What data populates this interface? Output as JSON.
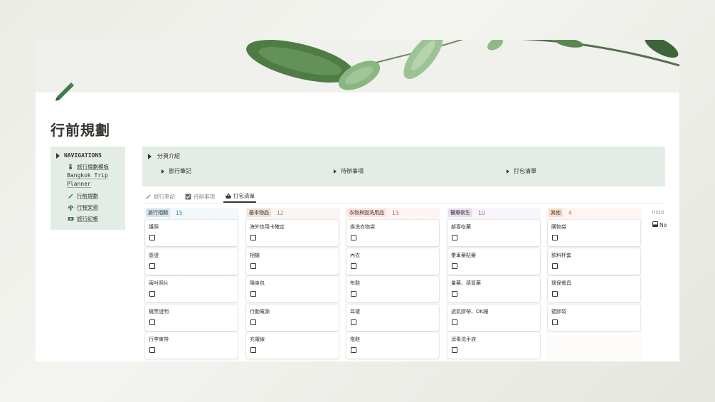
{
  "page": {
    "title": "行前規劃",
    "icon": "pencil-icon",
    "cover": "leaf-cover-image"
  },
  "navigations": {
    "header": "NAVIGATIONS",
    "items": [
      {
        "label": "旅行規劃模板",
        "icon": "traveler-icon"
      },
      {
        "label": "Bangkok Trip Planner",
        "line1": "Bangkok Trip",
        "line2": "Planner"
      },
      {
        "label": "行前規劃",
        "icon": "pencil-icon"
      },
      {
        "label": "行程安排",
        "icon": "cactus-icon"
      },
      {
        "label": "旅行記帳",
        "icon": "money-icon"
      }
    ]
  },
  "categories": {
    "header": "分頁介紹",
    "links": [
      "旅行筆記",
      "待辦事項",
      "打包清單"
    ]
  },
  "tabs": [
    {
      "label": "旅行筆記",
      "icon": "pencil-icon",
      "active": false
    },
    {
      "label": "待辦事項",
      "icon": "checkbox-icon",
      "active": false
    },
    {
      "label": "打包清單",
      "icon": "basket-icon",
      "active": true
    }
  ],
  "board": {
    "columns": [
      {
        "name": "旅行相關",
        "count": "15",
        "pill_color": "#d3e5ef",
        "count_color": "#487ca5",
        "bg": "#f3f8fb",
        "cards": [
          "護照",
          "簽證",
          "兩吋照片",
          "機票證明",
          "行李束帶"
        ]
      },
      {
        "name": "基本物品",
        "count": "12",
        "pill_color": "#eee0da",
        "count_color": "#b07a5a",
        "bg": "#faf6f3",
        "cards": [
          "海外信用卡確定",
          "相機",
          "隨身包",
          "行動電源",
          "充電線"
        ]
      },
      {
        "name": "衣物與盥洗用品",
        "count": "13",
        "pill_color": "#ffe2dd",
        "count_color": "#c4554d",
        "bg": "#fdf5f4",
        "cards": [
          "換洗衣物袋",
          "內衣",
          "布鞋",
          "耳環",
          "拖鞋"
        ]
      },
      {
        "name": "醫療衛生",
        "count": "10",
        "pill_color": "#e8deee",
        "count_color": "#9065b0",
        "bg": "#f9f6fb",
        "cards": [
          "部喜吃藥",
          "暈車藥貼藥",
          "量藥、感冒藥",
          "透氣膠帶、OK繃",
          "消毒洗手液"
        ]
      },
      {
        "name": "其他",
        "count": "4",
        "pill_color": "#fadec9",
        "count_color": "#cc782f",
        "bg": "#fdf6f1",
        "cards": [
          "購物袋",
          "飲料杯套",
          "環保餐具",
          "塑膠袋"
        ]
      }
    ],
    "hidden_label": "Hidd",
    "hidden_item": "No"
  }
}
